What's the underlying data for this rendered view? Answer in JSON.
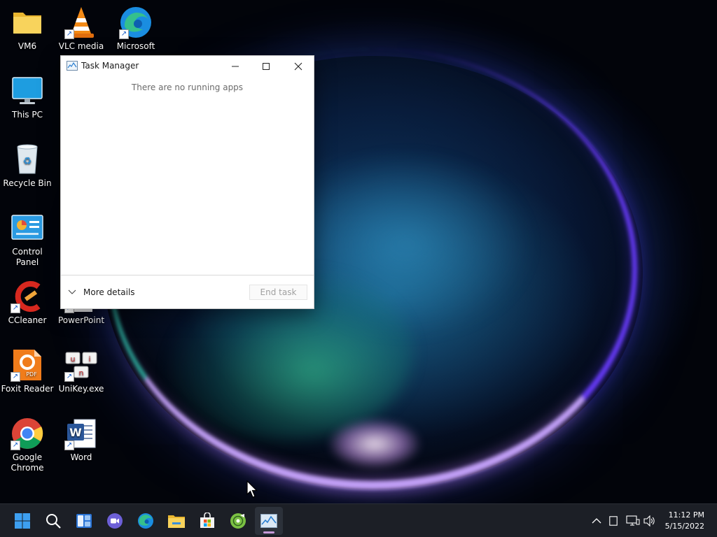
{
  "desktop": {
    "icons": [
      {
        "label": "VM6",
        "icon": "folder-icon",
        "shortcut": false
      },
      {
        "label": "VLC media",
        "icon": "vlc-icon",
        "shortcut": true
      },
      {
        "label": "Microsoft",
        "icon": "edge-icon",
        "shortcut": true
      },
      {
        "label": "This PC",
        "icon": "monitor-icon",
        "shortcut": false
      },
      {
        "label": "Recycle Bin",
        "icon": "recycle-bin-icon",
        "shortcut": false
      },
      {
        "label": "Control Panel",
        "icon": "control-panel-icon",
        "shortcut": false
      },
      {
        "label": "CCleaner",
        "icon": "ccleaner-icon",
        "shortcut": true
      },
      {
        "label": "PowerPoint",
        "icon": "powerpoint-icon",
        "shortcut": true
      },
      {
        "label": "Foxit Reader",
        "icon": "foxit-reader-icon",
        "shortcut": true
      },
      {
        "label": "UniKey.exe",
        "icon": "unikey-icon",
        "shortcut": true
      },
      {
        "label": "Google Chrome",
        "icon": "chrome-icon",
        "shortcut": true
      },
      {
        "label": "Word",
        "icon": "word-icon",
        "shortcut": true
      }
    ]
  },
  "task_manager": {
    "title": "Task Manager",
    "empty_message": "There are no running apps",
    "more_details": "More details",
    "end_task": "End task",
    "end_task_enabled": false
  },
  "taskbar": {
    "items": [
      {
        "name": "start",
        "icon": "windows-start-icon",
        "active": false
      },
      {
        "name": "search",
        "icon": "search-icon",
        "active": false
      },
      {
        "name": "widgets",
        "icon": "widgets-icon",
        "active": false
      },
      {
        "name": "chat",
        "icon": "teams-chat-icon",
        "active": false
      },
      {
        "name": "edge",
        "icon": "edge-icon",
        "active": false
      },
      {
        "name": "file-explorer",
        "icon": "folder-icon",
        "active": false
      },
      {
        "name": "store",
        "icon": "store-icon",
        "active": false
      },
      {
        "name": "media-app",
        "icon": "media-disc-icon",
        "active": false
      },
      {
        "name": "task-manager",
        "icon": "task-manager-icon",
        "active": true
      }
    ],
    "tray": {
      "icons": [
        "chevron-up-icon",
        "tablet-icon",
        "network-icon",
        "volume-icon"
      ],
      "time": "11:12 PM",
      "date": "5/15/2022"
    }
  },
  "colors": {
    "taskbar_bg": "#1c1f26",
    "active_indicator": "#c79ad9",
    "window_bg": "#ffffff"
  }
}
